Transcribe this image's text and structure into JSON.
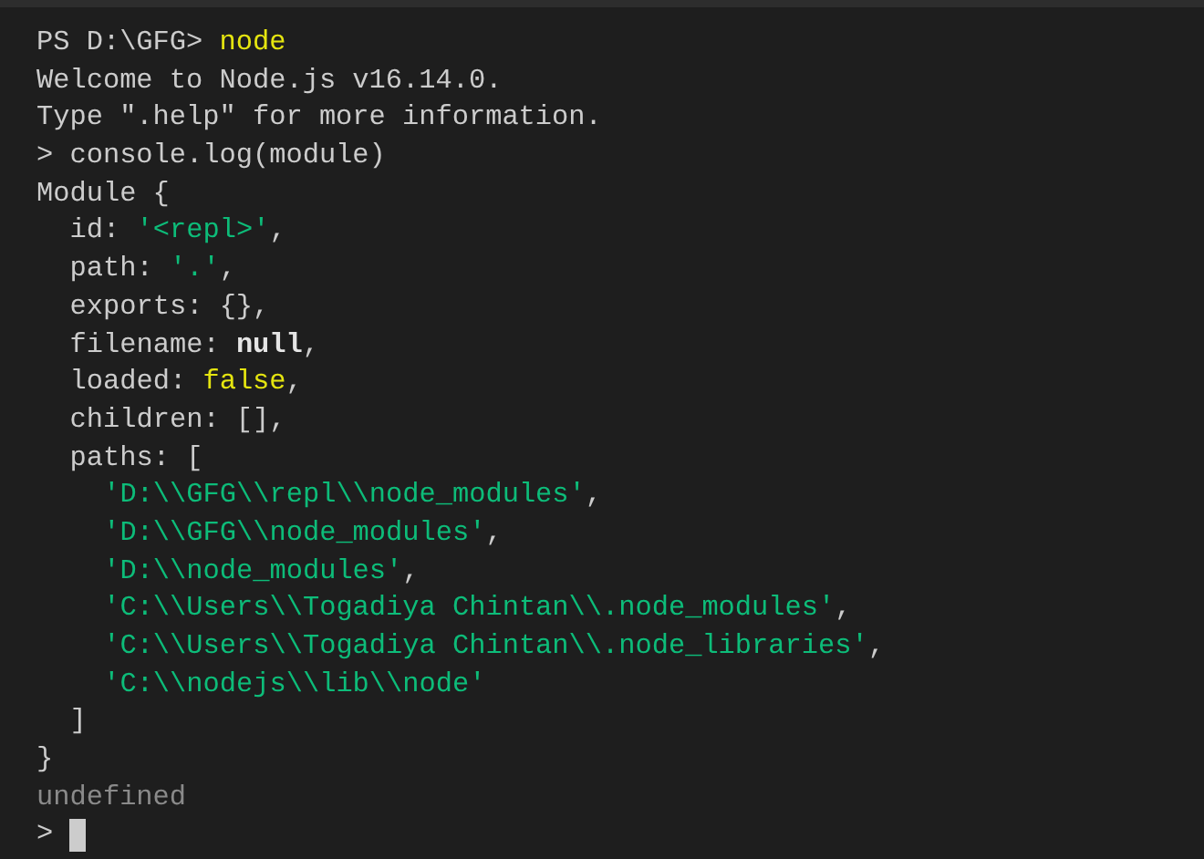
{
  "terminal": {
    "lines": [
      {
        "segments": [
          {
            "text": "PS D:\\GFG> ",
            "kind": "plain"
          },
          {
            "text": "node",
            "kind": "command"
          }
        ]
      },
      {
        "segments": [
          {
            "text": "Welcome to Node.js v16.14.0.",
            "kind": "plain"
          }
        ]
      },
      {
        "segments": [
          {
            "text": "Type \".help\" for more information.",
            "kind": "plain"
          }
        ]
      },
      {
        "segments": [
          {
            "text": "> console.log(module)",
            "kind": "plain"
          }
        ]
      },
      {
        "segments": [
          {
            "text": "Module {",
            "kind": "plain"
          }
        ],
        "children": [
          {
            "segments": [
              {
                "text": "id: ",
                "kind": "plain"
              },
              {
                "text": "'<repl>'",
                "kind": "string"
              },
              {
                "text": ",",
                "kind": "plain"
              }
            ]
          },
          {
            "segments": [
              {
                "text": "path: ",
                "kind": "plain"
              },
              {
                "text": "'.'",
                "kind": "string"
              },
              {
                "text": ",",
                "kind": "plain"
              }
            ]
          },
          {
            "segments": [
              {
                "text": "exports: {},",
                "kind": "plain"
              }
            ]
          },
          {
            "segments": [
              {
                "text": "filename: ",
                "kind": "plain"
              },
              {
                "text": "null",
                "kind": "null"
              },
              {
                "text": ",",
                "kind": "plain"
              }
            ]
          },
          {
            "segments": [
              {
                "text": "loaded: ",
                "kind": "plain"
              },
              {
                "text": "false",
                "kind": "boolean"
              },
              {
                "text": ",",
                "kind": "plain"
              }
            ]
          },
          {
            "segments": [
              {
                "text": "children: [],",
                "kind": "plain"
              }
            ]
          },
          {
            "segments": [
              {
                "text": "paths: [",
                "kind": "plain"
              }
            ],
            "children": [
              {
                "segments": [
                  {
                    "text": "'D:\\\\GFG\\\\repl\\\\node_modules'",
                    "kind": "string"
                  },
                  {
                    "text": ",",
                    "kind": "plain"
                  }
                ]
              },
              {
                "segments": [
                  {
                    "text": "'D:\\\\GFG\\\\node_modules'",
                    "kind": "string"
                  },
                  {
                    "text": ",",
                    "kind": "plain"
                  }
                ]
              },
              {
                "segments": [
                  {
                    "text": "'D:\\\\node_modules'",
                    "kind": "string"
                  },
                  {
                    "text": ",",
                    "kind": "plain"
                  }
                ]
              },
              {
                "segments": [
                  {
                    "text": "'C:\\\\Users\\\\Togadiya Chintan\\\\.node_modules'",
                    "kind": "string"
                  },
                  {
                    "text": ",",
                    "kind": "plain"
                  }
                ]
              },
              {
                "segments": [
                  {
                    "text": "'C:\\\\Users\\\\Togadiya Chintan\\\\.node_libraries'",
                    "kind": "string"
                  },
                  {
                    "text": ",",
                    "kind": "plain"
                  }
                ]
              },
              {
                "segments": [
                  {
                    "text": "'C:\\\\nodejs\\\\lib\\\\node'",
                    "kind": "string"
                  }
                ]
              }
            ]
          },
          {
            "segments": [
              {
                "text": "]",
                "kind": "plain"
              }
            ]
          }
        ]
      },
      {
        "segments": [
          {
            "text": "}",
            "kind": "plain"
          }
        ]
      },
      {
        "segments": [
          {
            "text": "undefined",
            "kind": "muted"
          }
        ]
      },
      {
        "segments": [
          {
            "text": "> ",
            "kind": "plain"
          }
        ],
        "cursor": true
      }
    ]
  }
}
